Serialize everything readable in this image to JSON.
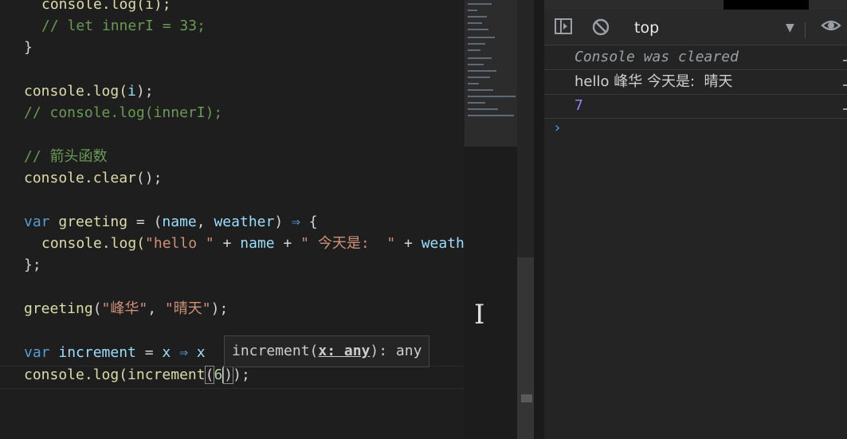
{
  "editor": {
    "code": {
      "l1_fn": "console",
      "l1_rest": ".log(i);",
      "l2": "// let innerI = 33;",
      "l3": "}",
      "l4_obj": "console",
      "l4_fn": ".log(",
      "l4_arg": "i",
      "l4_end": ");",
      "l5": "// console.log(innerI);",
      "l6": "// 箭头函数",
      "l7_obj": "console",
      "l7_fn": ".clear",
      "l7_end": "();",
      "l8_kw": "var",
      "l8_name": "greeting",
      "l8_eq": " = (",
      "l8_p1": "name",
      "l8_c": ", ",
      "l8_p2": "weather",
      "l8_close": ") ",
      "l8_arrow": "⇒",
      "l8_brace": " {",
      "l9_obj": "console",
      "l9_fn": ".log(",
      "l9_s1": "\"hello \"",
      "l9_plus1": " + ",
      "l9_v1": "name",
      "l9_plus2": " + ",
      "l9_s2": "\" 今天是:  \"",
      "l9_plus3": " + ",
      "l9_v2": "weath",
      "l10": "};",
      "l11_fn": "greeting",
      "l11_open": "(",
      "l11_s1": "\"峰华\"",
      "l11_c": ", ",
      "l11_s2": "\"晴天\"",
      "l11_end": ");",
      "l12_kw": "var",
      "l12_name": "increment",
      "l12_eq": " = ",
      "l12_x": "x",
      "l12_arrow": " ⇒ ",
      "l12_x2": "x",
      "l13_obj": "console",
      "l13_fn": ".log(",
      "l13_inner": "increment",
      "l13_open": "(",
      "l13_arg": "6",
      "l13_close": ")",
      "l13_end": ");"
    },
    "tooltip": {
      "prefix": "increment(",
      "param": "x: any",
      "suffix": "): any"
    }
  },
  "devtools": {
    "context": "top",
    "messages": [
      {
        "text": "Console was cleared",
        "kind": "cleared"
      },
      {
        "text": "hello 峰华 今天是:  晴天",
        "kind": "log"
      },
      {
        "text": "7",
        "kind": "number"
      }
    ],
    "prompt_symbol": "›"
  },
  "colors": {
    "keyword": "#569cd6",
    "function": "#dcdcaa",
    "variable": "#9cdcfe",
    "string": "#ce9178",
    "comment": "#6a9955",
    "number_output": "#9980ff",
    "prompt": "#4f9ce8"
  },
  "icons": [
    "sidebar-toggle-icon",
    "clear-console-icon",
    "dropdown-arrow-icon",
    "eye-icon",
    "i-beam-cursor-icon"
  ]
}
